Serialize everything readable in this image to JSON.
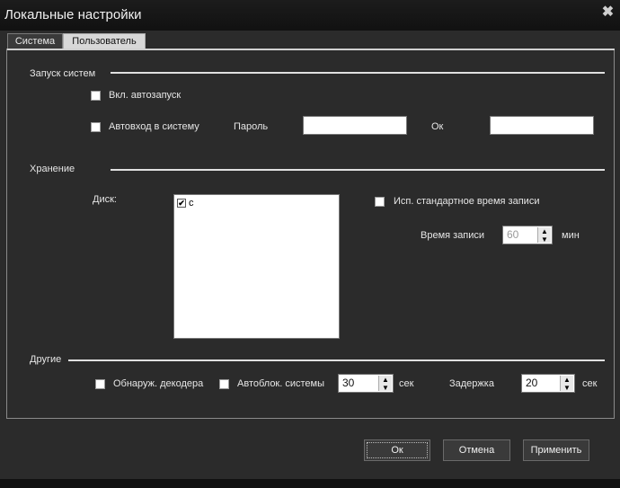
{
  "window": {
    "title": "Локальные настройки",
    "close_glyph": "✖"
  },
  "tabs": [
    {
      "label": "Система"
    },
    {
      "label": "Пользователь"
    }
  ],
  "startup": {
    "section_title": "Запуск систем",
    "autostart_label": "Вкл. автозапуск",
    "autologin_label": "Автовход в систему",
    "password_label": "Пароль",
    "ok_label": "Ок"
  },
  "storage": {
    "section_title": "Хранение",
    "disk_label": "Диск:",
    "disks": [
      {
        "name": "c",
        "checked": true
      }
    ],
    "standard_time_label": "Исп. стандартное время записи",
    "record_time_label": "Время записи",
    "record_time_value": "60",
    "record_time_unit": "мин"
  },
  "other": {
    "section_title": "Другие",
    "decoder_detect_label": "Обнаруж. декодера",
    "autolock_label": "Автоблок. системы",
    "autolock_value": "30",
    "autolock_unit": "сек",
    "delay_label": "Задержка",
    "delay_value": "20",
    "delay_unit": "сек"
  },
  "buttons": {
    "ok": "Ок",
    "cancel": "Отмена",
    "apply": "Применить"
  },
  "icons": {
    "spin_up": "▲",
    "spin_down": "▼",
    "check": "✔"
  }
}
